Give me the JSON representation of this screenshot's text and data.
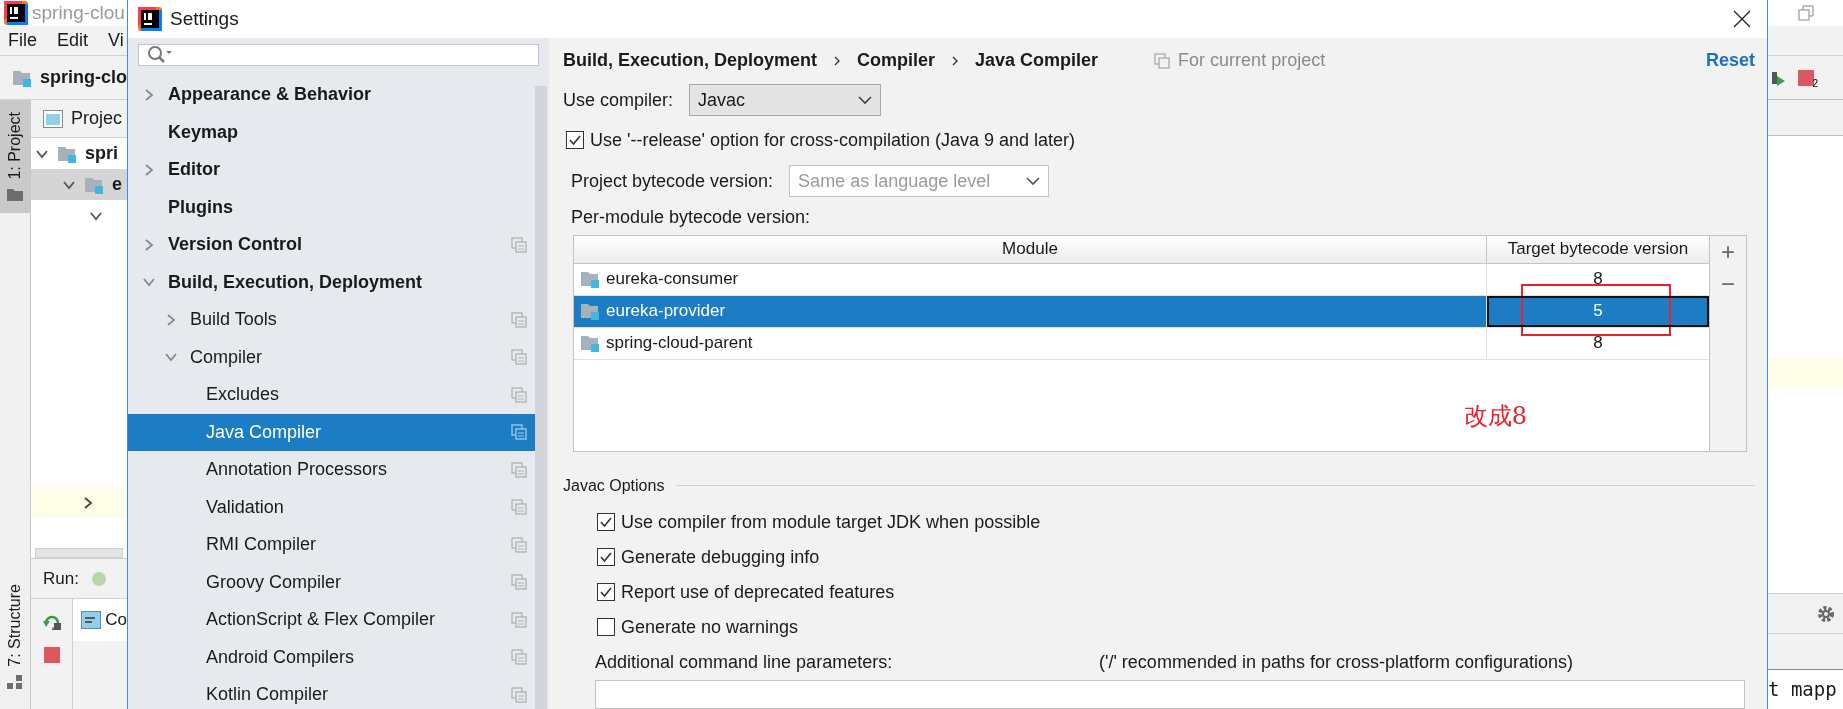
{
  "ide": {
    "title": "spring-clou",
    "menu": [
      "File",
      "Edit",
      "Vi"
    ],
    "project": "spring-clo",
    "tool_windows": [
      {
        "label": "1: Project",
        "selected": true
      },
      {
        "label": "7: Structure",
        "selected": false
      }
    ],
    "project_panel": {
      "title": "Projec",
      "rows": [
        {
          "label": "spri",
          "expanded": true,
          "selected": false
        },
        {
          "label": "e",
          "expanded": true,
          "selected": true
        },
        {
          "expanded": true,
          "selected": false
        }
      ]
    },
    "run": {
      "label": "Run:",
      "tab": "Co"
    },
    "toolbar_badge": "2",
    "editor_text": "t mapp"
  },
  "settings": {
    "title": "Settings",
    "nav": [
      {
        "label": "Appearance & Behavior",
        "expanded": false,
        "selected": false,
        "project_scoped": false
      },
      {
        "label": "Keymap",
        "selected": false,
        "project_scoped": false
      },
      {
        "label": "Editor",
        "expanded": false,
        "selected": false,
        "project_scoped": false
      },
      {
        "label": "Plugins",
        "selected": false,
        "project_scoped": false
      },
      {
        "label": "Version Control",
        "expanded": false,
        "selected": false,
        "project_scoped": true
      },
      {
        "label": "Build, Execution, Deployment",
        "expanded": true,
        "selected": false,
        "project_scoped": false,
        "children": [
          {
            "label": "Build Tools",
            "expanded": false,
            "selected": false,
            "project_scoped": true
          },
          {
            "label": "Compiler",
            "expanded": true,
            "selected": false,
            "project_scoped": true,
            "children": [
              {
                "label": "Excludes",
                "selected": false,
                "project_scoped": true
              },
              {
                "label": "Java Compiler",
                "selected": true,
                "project_scoped": true
              },
              {
                "label": "Annotation Processors",
                "selected": false,
                "project_scoped": true
              },
              {
                "label": "Validation",
                "selected": false,
                "project_scoped": true
              },
              {
                "label": "RMI Compiler",
                "selected": false,
                "project_scoped": true
              },
              {
                "label": "Groovy Compiler",
                "selected": false,
                "project_scoped": true
              },
              {
                "label": "ActionScript & Flex Compiler",
                "selected": false,
                "project_scoped": true
              },
              {
                "label": "Android Compilers",
                "selected": false,
                "project_scoped": true
              },
              {
                "label": "Kotlin Compiler",
                "selected": false,
                "project_scoped": true
              }
            ]
          }
        ]
      }
    ],
    "breadcrumb": [
      "Build, Execution, Deployment",
      "Compiler",
      "Java Compiler"
    ],
    "scope": "For current project",
    "reset": "Reset",
    "use_compiler": {
      "label": "Use compiler:",
      "value": "Javac"
    },
    "release_option": {
      "label": "Use '--release' option for cross-compilation (Java 9 and later)",
      "checked": true
    },
    "project_bytecode": {
      "label": "Project bytecode version:",
      "placeholder": "Same as language level"
    },
    "per_module": {
      "label": "Per-module bytecode version:",
      "columns": [
        "Module",
        "Target bytecode version"
      ],
      "rows": [
        {
          "module": "eureka-consumer",
          "version": "8",
          "selected": false,
          "marked": false
        },
        {
          "module": "eureka-provider",
          "version": "5",
          "selected": true,
          "marked": true
        },
        {
          "module": "spring-cloud-parent",
          "version": "8",
          "selected": false,
          "marked": false
        }
      ],
      "buttons": [
        "+",
        "−"
      ],
      "note": "改成8"
    },
    "javac": {
      "title": "Javac Options",
      "options": [
        {
          "label": "Use compiler from module target JDK when possible",
          "checked": true
        },
        {
          "label": "Generate debugging info",
          "checked": true
        },
        {
          "label": "Report use of deprecated features",
          "checked": true
        },
        {
          "label": "Generate no warnings",
          "checked": false
        }
      ],
      "additional": {
        "label": "Additional command line parameters:",
        "hint": "('/' recommended in paths for cross-platform configurations)"
      }
    }
  }
}
